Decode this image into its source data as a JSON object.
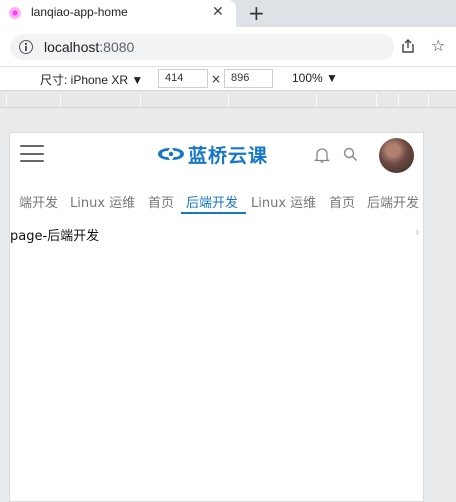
{
  "browser": {
    "tab_title": "lanqiao-app-home",
    "close_glyph": "✕",
    "newtab_glyph": "+",
    "url_host": "localhost",
    "url_port": ":8080",
    "star_glyph": "☆"
  },
  "device_toolbar": {
    "device_label": "尺寸: iPhone XR ▼",
    "width": "414",
    "height": "896",
    "times": "×",
    "zoom": "100% ▼"
  },
  "app": {
    "logo_text": "蓝桥云课",
    "brand_color": "#1677c8",
    "tabs": [
      {
        "label": "端开发",
        "active": false
      },
      {
        "label": "Linux 运维",
        "active": false
      },
      {
        "label": "首页",
        "active": false
      },
      {
        "label": "后端开发",
        "active": true
      },
      {
        "label": "Linux 运维",
        "active": false
      },
      {
        "label": "首页",
        "active": false
      },
      {
        "label": "后端开发",
        "active": false
      }
    ],
    "page_text": "page-后端开发"
  }
}
